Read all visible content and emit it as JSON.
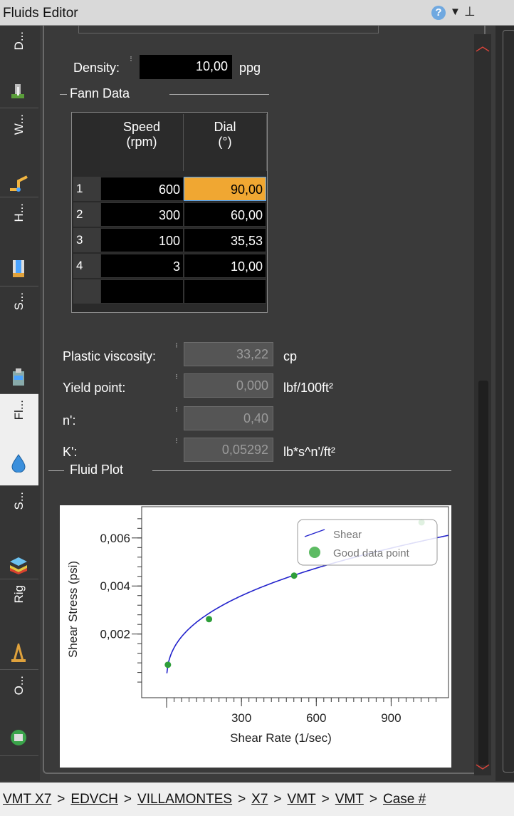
{
  "window": {
    "title": "Fluids Editor"
  },
  "side_tabs": [
    {
      "label": "D...",
      "icon": "drill-icon"
    },
    {
      "label": "W...",
      "icon": "wellpath-icon"
    },
    {
      "label": "H...",
      "icon": "hole-icon"
    },
    {
      "label": "S...",
      "icon": "string-icon"
    },
    {
      "label": "Fl...",
      "icon": "fluid-drop-icon"
    },
    {
      "label": "S...",
      "icon": "strata-icon"
    },
    {
      "label": "Rig",
      "icon": "rig-icon"
    },
    {
      "label": "O...",
      "icon": "operations-icon"
    }
  ],
  "density": {
    "label": "Density:",
    "value": "10,00",
    "unit": "ppg"
  },
  "fann": {
    "group_label": "Fann Data",
    "columns": [
      {
        "line1": "Speed",
        "line2": "(rpm)"
      },
      {
        "line1": "Dial",
        "line2": "(°)"
      }
    ],
    "rows": [
      {
        "index": "1",
        "speed": "600",
        "dial": "90,00"
      },
      {
        "index": "2",
        "speed": "300",
        "dial": "60,00"
      },
      {
        "index": "3",
        "speed": "100",
        "dial": "35,53"
      },
      {
        "index": "4",
        "speed": "3",
        "dial": "10,00"
      }
    ]
  },
  "properties": {
    "pv": {
      "label": "Plastic viscosity:",
      "value": "33,22",
      "unit": "cp"
    },
    "yp": {
      "label": "Yield point:",
      "value": "0,000",
      "unit": "lbf/100ft²"
    },
    "n": {
      "label": "n':",
      "value": "0,40",
      "unit": ""
    },
    "k": {
      "label": "K':",
      "value": "0,05292",
      "unit": "lb*s^n'/ft²"
    }
  },
  "plot": {
    "group_label": "Fluid Plot"
  },
  "chart_data": {
    "type": "line",
    "xlabel": "Shear Rate (1/sec)",
    "ylabel": "Shear Stress (psi)",
    "xlim": [
      -100,
      1130
    ],
    "ylim": [
      -0.00065,
      0.0073
    ],
    "x_ticks": [
      "300",
      "600",
      "900"
    ],
    "y_ticks": [
      "0,002",
      "0,004",
      "0,006"
    ],
    "x_tick_values": [
      300,
      600,
      900
    ],
    "y_tick_values": [
      0.002,
      0.004,
      0.006
    ],
    "series": [
      {
        "name": "Shear",
        "kind": "line",
        "color": "#2222cc",
        "k": 0.000367,
        "n": 0.4
      },
      {
        "name": "Good data point",
        "kind": "scatter",
        "color": "#2e9e3a",
        "x": [
          5.1,
          170,
          511,
          1022
        ],
        "y": [
          0.00072,
          0.00262,
          0.00443,
          0.00665
        ]
      }
    ],
    "legend": "top-right"
  },
  "breadcrumb": [
    "VMT X7",
    "EDVCH",
    "VILLAMONTES",
    "X7",
    "VMT",
    "VMT",
    "Case #"
  ]
}
